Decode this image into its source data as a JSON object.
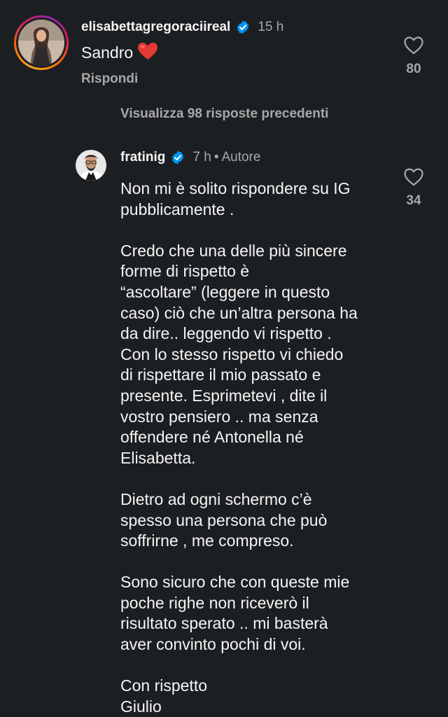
{
  "comments": [
    {
      "username": "elisabettagregoraciireal",
      "time": "15 h",
      "text": "Sandro",
      "like_count": "80",
      "reply_label": "Rispondi"
    },
    {
      "username": "fratinig",
      "time": "7 h",
      "author_badge": "Autore",
      "text": "Non mi è solito rispondere su IG\npubblicamente .\n\nCredo che una delle più sincere\nforme di rispetto è\n“ascoltare” (leggere in questo\ncaso) ciò che un’altra persona ha\nda dire.. leggendo vi rispetto .\nCon lo stesso rispetto vi chiedo\ndi rispettare il mio passato e\npresente. Esprimetevi , dite il\nvostro pensiero .. ma senza\noffendere né Antonella né\nElisabetta.\n\nDietro ad ogni schermo c’è\nspesso una persona che può\nsoffrirne , me compreso.\n\nSono sicuro che con queste mie\npoche righe non riceverò il\nrisultato sperato .. mi basterà\naver convinto pochi di voi.\n\nCon rispetto\nGiulio",
      "like_count": "34"
    }
  ],
  "view_replies_label": "Visualizza 98 risposte precedenti",
  "colors": {
    "background": "#1c1f22",
    "verified": "#0095f6",
    "secondary_text": "#a8a8a8",
    "heart_emoji": "#e53935"
  },
  "icons": {
    "like": "heart-outline-icon",
    "verified": "verified-badge-icon",
    "emoji": "red-heart-emoji"
  }
}
